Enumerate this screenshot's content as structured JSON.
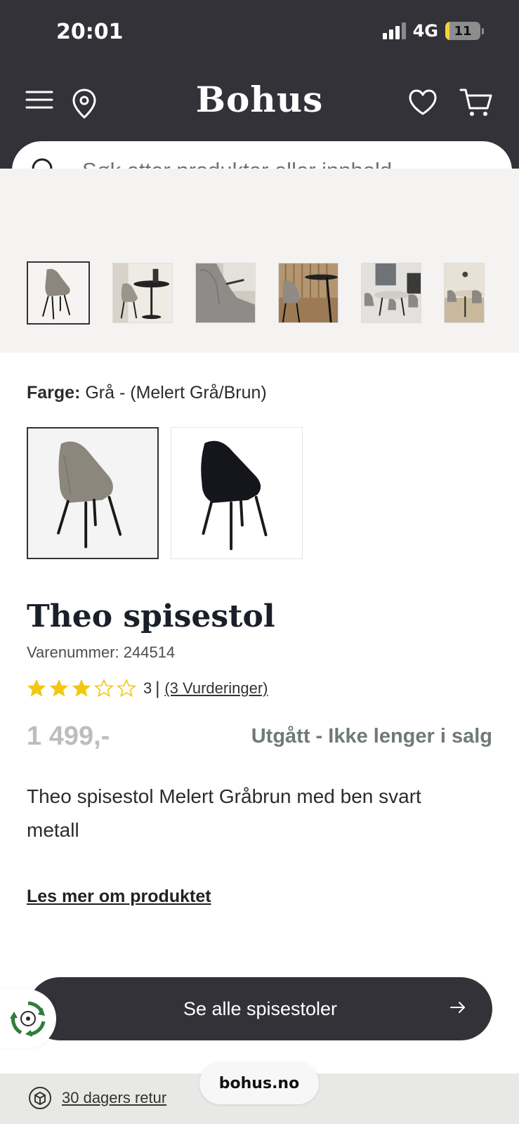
{
  "status_bar": {
    "time": "20:01",
    "network": "4G",
    "battery": "11",
    "battery_level": 0.11
  },
  "header": {
    "brand": "Bohus"
  },
  "search": {
    "placeholder": "Søk etter produkter eller innhold ..."
  },
  "gallery": {
    "thumbnails": [
      {
        "icon": "chair-grey-icon"
      },
      {
        "icon": "chair-table-scene-icon"
      },
      {
        "icon": "chair-closeup-icon"
      },
      {
        "icon": "chair-wood-scene-icon"
      },
      {
        "icon": "dining-room-scene-icon"
      },
      {
        "icon": "dining-set-scene-icon"
      }
    ]
  },
  "color": {
    "label": "Farge:",
    "value": "Grå - (Melert Grå/Brun)",
    "options": [
      {
        "name": "Grå",
        "color": "#8b877c"
      },
      {
        "name": "Svart",
        "color": "#15161c"
      }
    ]
  },
  "product": {
    "title": "Theo spisestol",
    "sku": "Varenummer: 244514",
    "rating_value": "3",
    "rating_separator": "|",
    "rating_link": "(3 Vurderinger)",
    "stars_filled": 3,
    "stars_total": 5,
    "price": "1 499,-",
    "availability": "Utgått - Ikke lenger i salg",
    "description": "Theo spisestol Melert Gråbrun med ben svart metall",
    "read_more": "Les mer om produktet"
  },
  "cta": {
    "label": "Se alle spisestoler"
  },
  "footer": {
    "return_label": "30 dagers retur",
    "url": "bohus.no"
  },
  "colors": {
    "header_bg": "#333238",
    "star": "#f3c613",
    "status_text": "#6f7a76",
    "gallery_bg": "#f4f3f1"
  }
}
